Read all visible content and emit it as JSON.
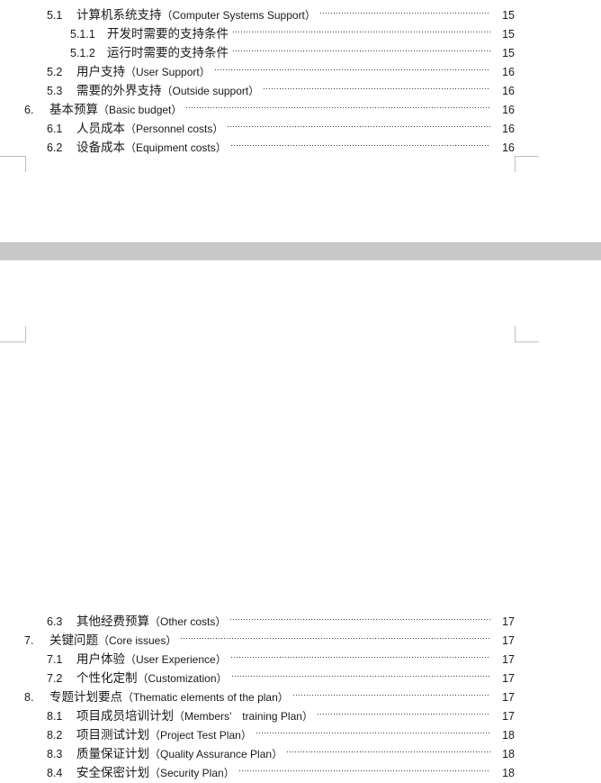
{
  "document": {
    "view": "print-layout",
    "page_gap_color": "#c8c8c8",
    "crop_mark_color": "#bfbfbf",
    "text_color": "#1a1a1a"
  },
  "toc": {
    "upper_page_entries": [
      {
        "number": "5.1",
        "title_cn": "计算机系统支持",
        "title_en": "（Computer Systems Support）",
        "page": "15",
        "level": 2
      },
      {
        "number": "5.1.1",
        "title_cn": "开发时需要的支持条件",
        "title_en": "",
        "page": "15",
        "level": 3
      },
      {
        "number": "5.1.2",
        "title_cn": "运行时需要的支持条件",
        "title_en": "",
        "page": "15",
        "level": 3
      },
      {
        "number": "5.2",
        "title_cn": "用户支持",
        "title_en": "（User Support）",
        "page": "16",
        "level": 2
      },
      {
        "number": "5.3",
        "title_cn": "需要的外界支持",
        "title_en": "（Outside support）",
        "page": "16",
        "level": 2
      },
      {
        "number": "6.",
        "title_cn": "基本预算",
        "title_en": "（Basic budget）",
        "page": "16",
        "level": 1
      },
      {
        "number": "6.1",
        "title_cn": "人员成本",
        "title_en": "（Personnel costs）",
        "page": "16",
        "level": 2
      },
      {
        "number": "6.2",
        "title_cn": "设备成本",
        "title_en": "（Equipment costs）",
        "page": "16",
        "level": 2
      }
    ],
    "lower_page_entries": [
      {
        "number": "6.3",
        "title_cn": "其他经费预算",
        "title_en": "（Other costs）",
        "page": "17",
        "level": 2
      },
      {
        "number": "7.",
        "title_cn": "关键问题",
        "title_en": "（Core issues）",
        "page": "17",
        "level": 1
      },
      {
        "number": "7.1",
        "title_cn": "用户体验",
        "title_en": "（User Experience）",
        "page": "17",
        "level": 2
      },
      {
        "number": "7.2",
        "title_cn": "个性化定制",
        "title_en": "（Customization）",
        "page": "17",
        "level": 2
      },
      {
        "number": "8.",
        "title_cn": "专题计划要点",
        "title_en": "（Thematic elements of the plan）",
        "page": "17",
        "level": 1
      },
      {
        "number": "8.1",
        "title_cn": "项目成员培训计划",
        "title_en": "（Members’　training Plan）",
        "page": "17",
        "level": 2
      },
      {
        "number": "8.2",
        "title_cn": "项目测试计划",
        "title_en": "（Project Test Plan）",
        "page": "18",
        "level": 2
      },
      {
        "number": "8.3",
        "title_cn": "质量保证计划",
        "title_en": "（Quality Assurance Plan）",
        "page": "18",
        "level": 2
      },
      {
        "number": "8.4",
        "title_cn": "安全保密计划",
        "title_en": "（Security Plan）",
        "page": "18",
        "level": 2
      }
    ]
  }
}
